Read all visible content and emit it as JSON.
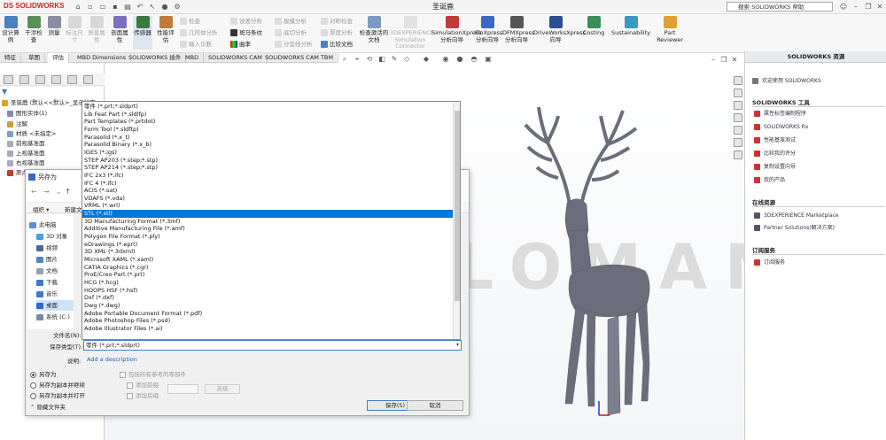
{
  "app": {
    "logo": "DS SOLIDWORKS",
    "window_title": "圣诞鹿",
    "help_search_placeholder": "搜索 SOLIDWORKS 帮助"
  },
  "ribbon": {
    "buttons": [
      {
        "label": "设计算例",
        "icon": "design-study-icon",
        "enabled": true
      },
      {
        "label": "干涉检查",
        "icon": "interference-icon",
        "enabled": true
      },
      {
        "label": "测量",
        "icon": "measure-icon",
        "enabled": true
      },
      {
        "label": "标注尺寸",
        "icon": "markup-icon",
        "enabled": false
      },
      {
        "label": "质量属性",
        "icon": "mass-properties-icon",
        "enabled": false
      },
      {
        "label": "剖面属性",
        "icon": "section-properties-icon",
        "enabled": true
      },
      {
        "label": "传感器",
        "icon": "sensor-icon",
        "enabled": true
      },
      {
        "label": "性能评估",
        "icon": "performance-icon",
        "enabled": true
      }
    ],
    "small_items": [
      "检查",
      "几何体分析",
      "输入诊断",
      "误差分析",
      "斑马条纹",
      "曲率",
      "拔模分析",
      "底切分析",
      "分型线分析",
      "对称检查",
      "厚度分析",
      "比较文档"
    ],
    "right_buttons": [
      {
        "label": "检查激活的文档",
        "icon": "check-active-icon",
        "enabled": true
      },
      {
        "label": "3DEXPERIENCE Simulation Connector",
        "icon": "3dx-icon",
        "enabled": false
      },
      {
        "label": "SimulationXpress 分析向导",
        "icon": "simxpress-icon",
        "enabled": true
      },
      {
        "label": "FloXpress 分析向导",
        "icon": "floxpress-icon",
        "enabled": true
      },
      {
        "label": "DFMXpress 分析向导",
        "icon": "dfmxpress-icon",
        "enabled": true
      },
      {
        "label": "DriveWorksXpress 向导",
        "icon": "driveworks-icon",
        "enabled": true
      },
      {
        "label": "Costing",
        "icon": "costing-icon",
        "enabled": true
      },
      {
        "label": "Sustainability",
        "icon": "sustainability-icon",
        "enabled": true
      },
      {
        "label": "Part Reviewer",
        "icon": "part-reviewer-icon",
        "enabled": true
      }
    ]
  },
  "tabs": [
    "特征",
    "草图",
    "评估",
    "MBD Dimensions",
    "SOLIDWORKS 插件",
    "MBD",
    "SOLIDWORKS CAM",
    "SOLIDWORKS CAM TBM"
  ],
  "active_tab": "评估",
  "feature_tree": [
    "圣诞鹿 (默认<<默认>_显示状态",
    "图形实体(1)",
    "注解",
    "材质 <未指定>",
    "前视基准面",
    "上视基准面",
    "右视基准面",
    "原点"
  ],
  "right_panel": {
    "title": "SOLIDWORKS 资源",
    "welcome": "欢迎使用 SOLIDWORKS",
    "sections": [
      {
        "title": "SOLIDWORKS 工具",
        "items": [
          "属性标签编制程序",
          "SOLIDWORKS Rx",
          "性能基准测试",
          "比较我的评分",
          "复制设置向导",
          "我的产品"
        ]
      },
      {
        "title": "在线资源",
        "items": [
          "3DEXPERIENCE Marketplace",
          "Partner Solutions(解决方案)"
        ]
      },
      {
        "title": "订阅服务",
        "items": [
          "订阅服务"
        ]
      }
    ]
  },
  "watermark": "SALOMAN",
  "save_dialog": {
    "title": "另存为",
    "toolbar_organize": "组织 ▾",
    "toolbar_new": "新建文件夹",
    "nav": [
      "此电脑",
      "3D 对象",
      "视频",
      "图片",
      "文档",
      "下载",
      "音乐",
      "桌面",
      "系统 (C:)"
    ],
    "selected_nav": "桌面",
    "file_name_label": "文件名(N):",
    "file_type_label": "保存类型(T):",
    "file_type_value": "零件 (*.prt;*.sldprt)",
    "description_label": "说明:",
    "description_link": "Add a description",
    "save_options": [
      "另存为",
      "另存为副本并继续",
      "另存为副本并打开"
    ],
    "selected_option": "另存为",
    "include_refs": "包括所有参考的零部件",
    "add_prefix": "添加前缀",
    "add_suffix": "添加后缀",
    "browse": "高级",
    "hide_folders": "隐藏文件夹",
    "save_button": "保存(S)",
    "cancel_button": "取消"
  },
  "file_type_options": [
    "零件 (*.prt;*.sldprt)",
    "Lib Feat Part (*.sldlfp)",
    "Part Templates (*.prtdot)",
    "Form Tool (*.sldftp)",
    "Parasolid (*.x_t)",
    "Parasolid Binary (*.x_b)",
    "IGES (*.igs)",
    "STEP AP203 (*.step;*.stp)",
    "STEP AP214 (*.step;*.stp)",
    "IFC 2x3 (*.ifc)",
    "IFC 4 (*.ifc)",
    "ACIS (*.sat)",
    "VDAFS (*.vda)",
    "VRML (*.wrl)",
    "STL (*.stl)",
    "3D Manufacturing Format (*.3mf)",
    "Additive Manufacturing File (*.amf)",
    "Polygon File Format (*.ply)",
    "eDrawings (*.eprt)",
    "3D XML (*.3dxml)",
    "Microsoft XAML (*.xaml)",
    "CATIA Graphics (*.cgr)",
    "ProE/Creo Part (*.prt)",
    "HCG (*.hcg)",
    "HOOPS HSF (*.hsf)",
    "Dxf (*.dxf)",
    "Dwg (*.dwg)",
    "Adobe Portable Document Format (*.pdf)",
    "Adobe Photoshop Files (*.psd)",
    "Adobe Illustrator Files (*.ai)"
  ],
  "selected_file_type": "STL (*.stl)",
  "colors": {
    "accent": "#0078d7",
    "brand": "#d22222",
    "model": "#6b6e7a"
  }
}
